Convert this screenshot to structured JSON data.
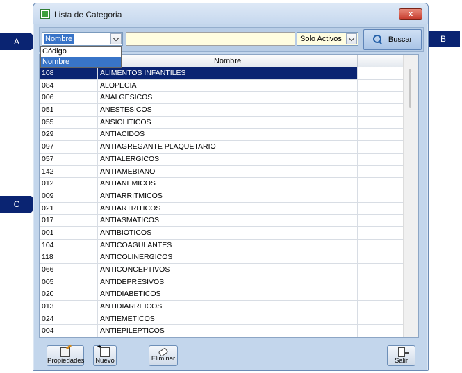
{
  "callouts": {
    "a": "A",
    "b": "B",
    "c": "C"
  },
  "window": {
    "title": "Lista de Categoria",
    "close_label": "x"
  },
  "toolbar": {
    "field_combo_value": "Nombre",
    "search_value": "",
    "status_combo_value": "Solo Activos",
    "search_button_label": "Buscar"
  },
  "dropdown": {
    "options": [
      "Código",
      "Nombre"
    ],
    "selected_index": 1
  },
  "grid": {
    "headers": [
      "",
      "Nombre",
      ""
    ],
    "rows": [
      {
        "code": "108",
        "name": "ALIMENTOS INFANTILES",
        "selected": true
      },
      {
        "code": "084",
        "name": "ALOPECIA"
      },
      {
        "code": "006",
        "name": "ANALGESICOS"
      },
      {
        "code": "051",
        "name": "ANESTESICOS"
      },
      {
        "code": "055",
        "name": "ANSIOLITICOS"
      },
      {
        "code": "029",
        "name": "ANTIACIDOS"
      },
      {
        "code": "097",
        "name": "ANTIAGREGANTE PLAQUETARIO"
      },
      {
        "code": "057",
        "name": "ANTIALERGICOS"
      },
      {
        "code": "142",
        "name": "ANTIAMEBIANO"
      },
      {
        "code": "012",
        "name": "ANTIANEMICOS"
      },
      {
        "code": "009",
        "name": "ANTIARRITMICOS"
      },
      {
        "code": "021",
        "name": "ANTIARTRITICOS"
      },
      {
        "code": "017",
        "name": "ANTIASMATICOS"
      },
      {
        "code": "001",
        "name": "ANTIBIOTICOS"
      },
      {
        "code": "104",
        "name": "ANTICOAGULANTES"
      },
      {
        "code": "118",
        "name": "ANTICOLINERGICOS"
      },
      {
        "code": "066",
        "name": "ANTICONCEPTIVOS"
      },
      {
        "code": "005",
        "name": "ANTIDEPRESIVOS"
      },
      {
        "code": "020",
        "name": "ANTIDIABETICOS"
      },
      {
        "code": "013",
        "name": "ANTIDIARREICOS"
      },
      {
        "code": "024",
        "name": "ANTIEMETICOS"
      },
      {
        "code": "004",
        "name": "ANTIEPILEPTICOS"
      }
    ]
  },
  "buttons": {
    "propiedades": "Propiedades",
    "nuevo": "Nuevo",
    "eliminar": "Eliminar",
    "salir": "Salir"
  },
  "colors": {
    "selection": "#0a2472",
    "combo_highlight": "#3874c8",
    "window_bg": "#c3d6ec"
  }
}
